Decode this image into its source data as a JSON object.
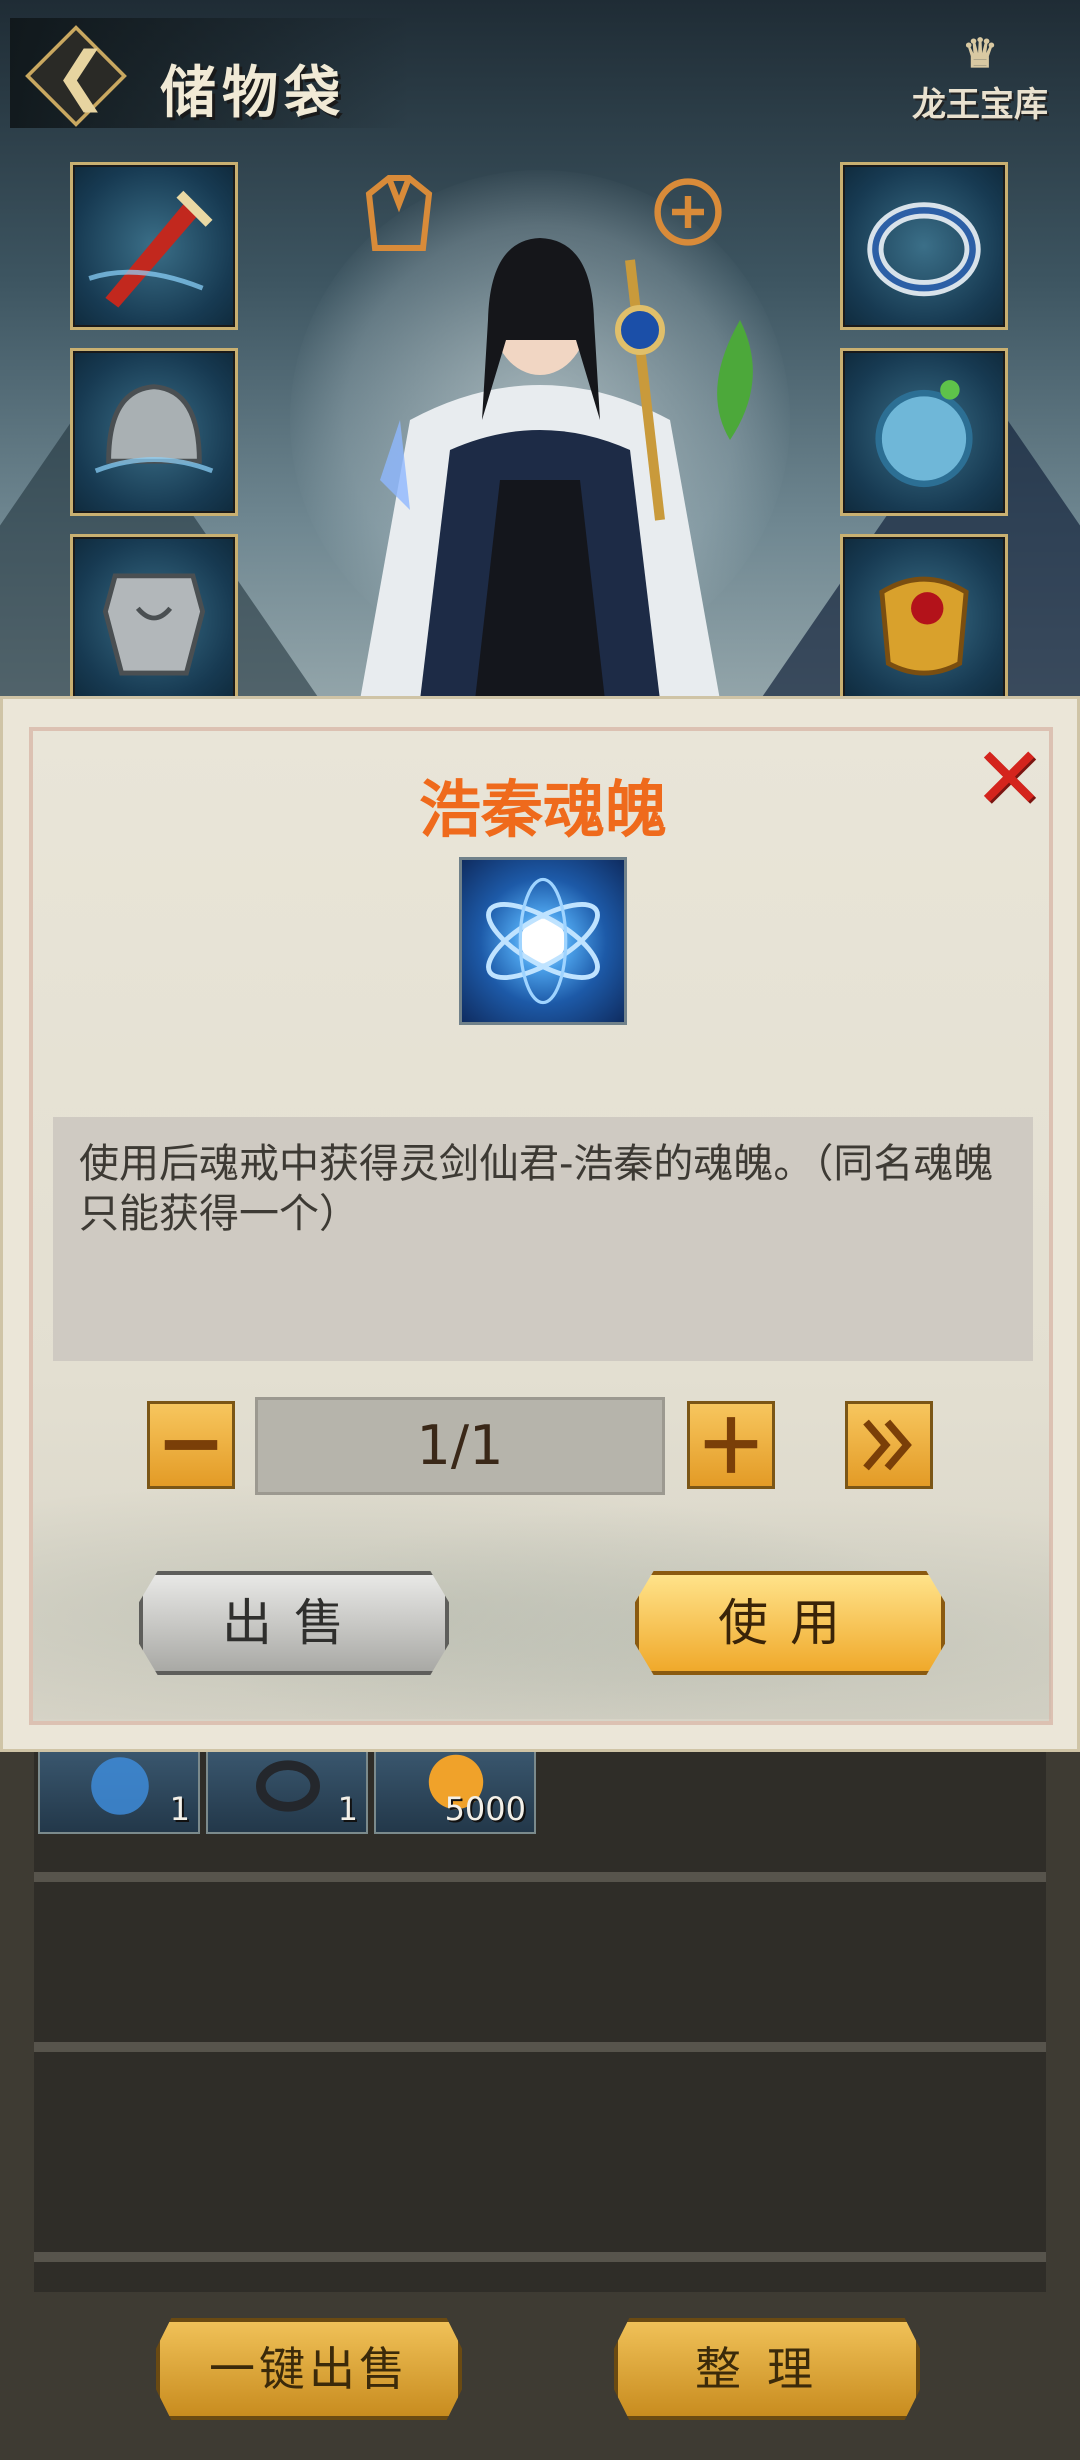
{
  "header": {
    "title": "储物袋",
    "treasury_logo": "龙王宝库"
  },
  "equipment_slots": {
    "left": [
      "sword-icon",
      "helmet-icon",
      "armor-icon"
    ],
    "right": [
      "ring-icon",
      "orb-icon",
      "amulet-icon"
    ]
  },
  "dialog": {
    "item_name": "浩秦魂魄",
    "item_icon": "soul-orb-icon",
    "description": "使用后魂戒中获得灵剑仙君-浩秦的魂魄。（同名魂魄只能获得一个）",
    "quantity": "1/1",
    "sell_label": "出售",
    "use_label": "使用"
  },
  "bag": {
    "items": [
      {
        "icon": "soul-orb-icon",
        "count": "1"
      },
      {
        "icon": "ring-icon",
        "count": "1"
      },
      {
        "icon": "gold-coin-icon",
        "count": "5000"
      }
    ]
  },
  "bottom_actions": {
    "sell_all_label": "一键出售",
    "organize_label": "整理"
  },
  "colors": {
    "title_orange": "#ef6a1c",
    "close_red": "#d4241d",
    "gold_button": "#f0a92b"
  }
}
